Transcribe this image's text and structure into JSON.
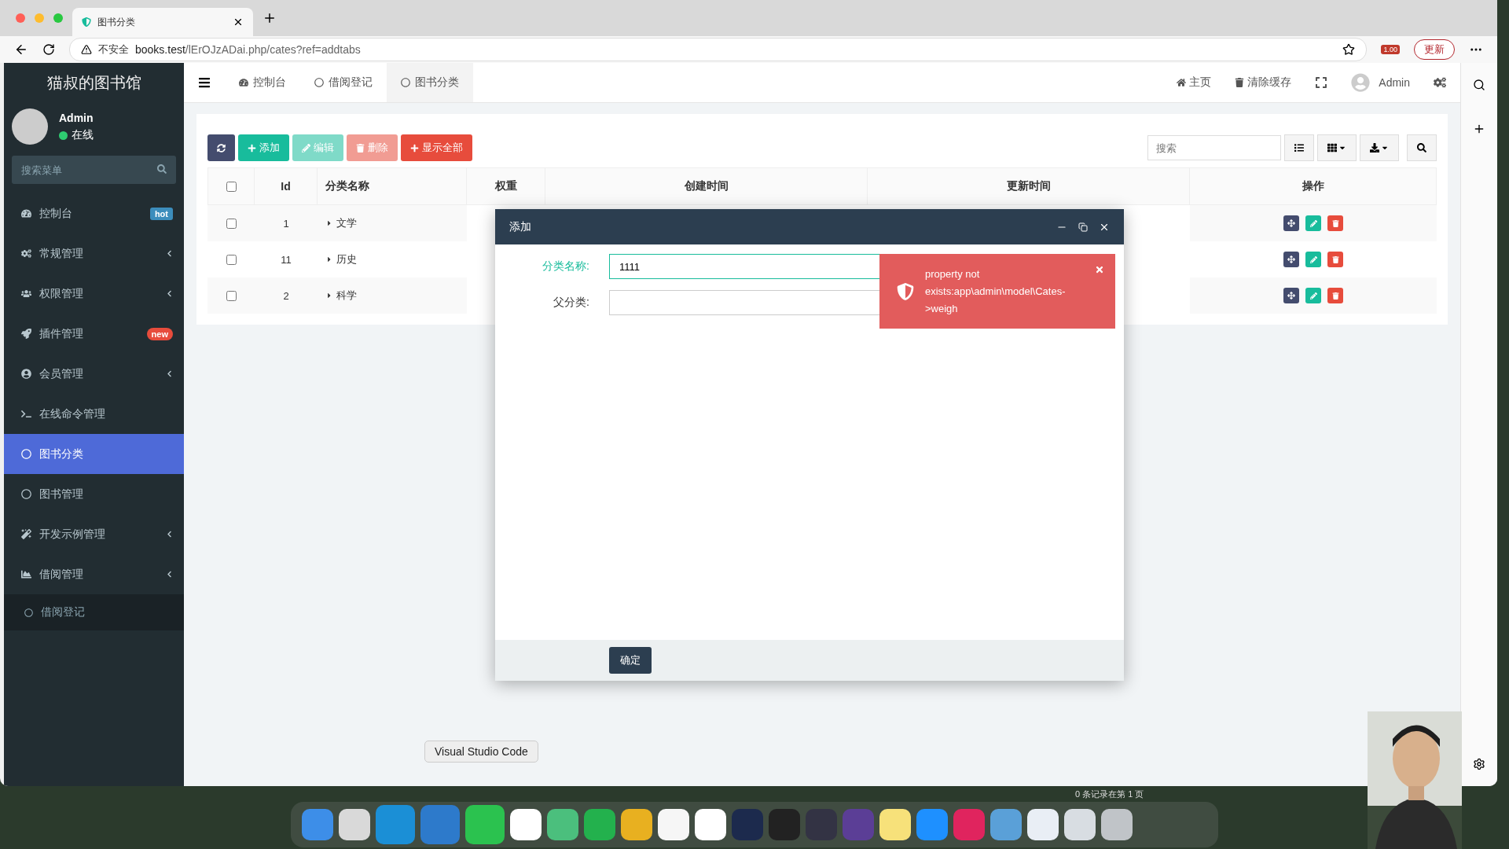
{
  "browser": {
    "tab_title": "图书分类",
    "security": "不安全",
    "url_host": "books.test",
    "url_path": "/lErOJzADai.php/cates?ref=addtabs",
    "extension_badge": "1.00",
    "update_button": "更新"
  },
  "sidebar": {
    "brand": "猫叔的图书馆",
    "user": {
      "name": "Admin",
      "status": "在线"
    },
    "search": {
      "placeholder": "搜索菜单"
    },
    "items": [
      {
        "label": "控制台",
        "badge": "hot",
        "color": "#3c8dbc",
        "chevron": false,
        "selected": false
      },
      {
        "label": "常规管理",
        "chevron": true,
        "selected": false
      },
      {
        "label": "权限管理",
        "chevron": true,
        "selected": false
      },
      {
        "label": "插件管理",
        "badge": "new",
        "color": "#e74c3c",
        "chevron": false,
        "selected": false
      },
      {
        "label": "会员管理",
        "chevron": true,
        "selected": false
      },
      {
        "label": "在线命令管理",
        "chevron": false,
        "selected": false
      },
      {
        "label": "图书分类",
        "chevron": false,
        "selected": true
      },
      {
        "label": "图书管理",
        "chevron": false,
        "selected": false
      },
      {
        "label": "开发示例管理",
        "chevron": true,
        "selected": false
      },
      {
        "label": "借阅管理",
        "chevron": true,
        "selected": false,
        "children": [
          {
            "label": "借阅登记",
            "selected": false
          }
        ]
      }
    ]
  },
  "topnav": {
    "tabs": [
      {
        "label": "控制台",
        "selected": false
      },
      {
        "label": "借阅登记",
        "selected": false
      },
      {
        "label": "图书分类",
        "selected": true
      }
    ],
    "links": [
      "主页",
      "清除缓存"
    ],
    "user": "Admin"
  },
  "toolbar": {
    "buttons": [
      {
        "kind": "refresh",
        "disabled": false
      },
      {
        "kind": "add",
        "label": "添加",
        "disabled": false
      },
      {
        "kind": "edit",
        "label": "编辑",
        "disabled": true
      },
      {
        "kind": "delete",
        "label": "删除",
        "disabled": true
      },
      {
        "kind": "showall",
        "label": "显示全部",
        "disabled": false
      }
    ],
    "search": {
      "placeholder": "搜索"
    }
  },
  "table": {
    "all_checked": false,
    "columns": [
      "Id",
      "分类名称",
      "权重",
      "创建时间",
      "更新时间",
      "操作"
    ],
    "rows": [
      {
        "checked": false,
        "id": "1",
        "name": "文学"
      },
      {
        "checked": false,
        "id": "11",
        "name": "历史"
      },
      {
        "checked": false,
        "id": "2",
        "name": "科学"
      }
    ]
  },
  "dialog": {
    "title": "添加",
    "fields": [
      {
        "label": "分类名称:",
        "value": "1111",
        "focused": true
      },
      {
        "label": "父分类:",
        "focused": false
      }
    ],
    "submit": "确定"
  },
  "toast": {
    "message": "property not exists:app\\admin\\model\\Cates->weigh"
  },
  "dock": {
    "tooltip": "Visual Studio Code",
    "behind_text": "0 条记录在第 1 页"
  }
}
